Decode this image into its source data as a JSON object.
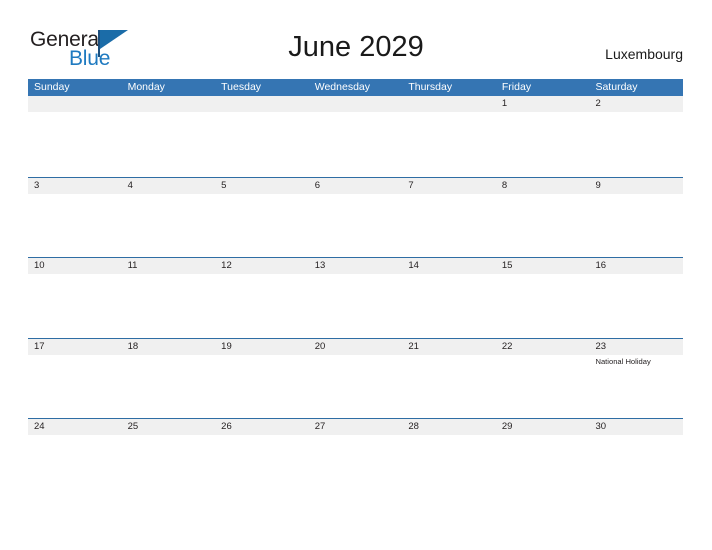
{
  "logo": {
    "word_top": "General",
    "word_bottom": "Blue",
    "icon": "blue-flag-triangle"
  },
  "header": {
    "title": "June 2029",
    "country": "Luxembourg"
  },
  "colors": {
    "header_blue": "#3575b3",
    "rule_blue": "#2e6da4",
    "band_gray": "#f0f0f0",
    "logo_blue": "#1f7ac0",
    "text_dark": "#231f20"
  },
  "calendar": {
    "day_headers": [
      "Sunday",
      "Monday",
      "Tuesday",
      "Wednesday",
      "Thursday",
      "Friday",
      "Saturday"
    ],
    "weeks": [
      [
        {
          "date": "",
          "event": ""
        },
        {
          "date": "",
          "event": ""
        },
        {
          "date": "",
          "event": ""
        },
        {
          "date": "",
          "event": ""
        },
        {
          "date": "",
          "event": ""
        },
        {
          "date": "1",
          "event": ""
        },
        {
          "date": "2",
          "event": ""
        }
      ],
      [
        {
          "date": "3",
          "event": ""
        },
        {
          "date": "4",
          "event": ""
        },
        {
          "date": "5",
          "event": ""
        },
        {
          "date": "6",
          "event": ""
        },
        {
          "date": "7",
          "event": ""
        },
        {
          "date": "8",
          "event": ""
        },
        {
          "date": "9",
          "event": ""
        }
      ],
      [
        {
          "date": "10",
          "event": ""
        },
        {
          "date": "11",
          "event": ""
        },
        {
          "date": "12",
          "event": ""
        },
        {
          "date": "13",
          "event": ""
        },
        {
          "date": "14",
          "event": ""
        },
        {
          "date": "15",
          "event": ""
        },
        {
          "date": "16",
          "event": ""
        }
      ],
      [
        {
          "date": "17",
          "event": ""
        },
        {
          "date": "18",
          "event": ""
        },
        {
          "date": "19",
          "event": ""
        },
        {
          "date": "20",
          "event": ""
        },
        {
          "date": "21",
          "event": ""
        },
        {
          "date": "22",
          "event": ""
        },
        {
          "date": "23",
          "event": "National Holiday"
        }
      ],
      [
        {
          "date": "24",
          "event": ""
        },
        {
          "date": "25",
          "event": ""
        },
        {
          "date": "26",
          "event": ""
        },
        {
          "date": "27",
          "event": ""
        },
        {
          "date": "28",
          "event": ""
        },
        {
          "date": "29",
          "event": ""
        },
        {
          "date": "30",
          "event": ""
        }
      ]
    ]
  }
}
